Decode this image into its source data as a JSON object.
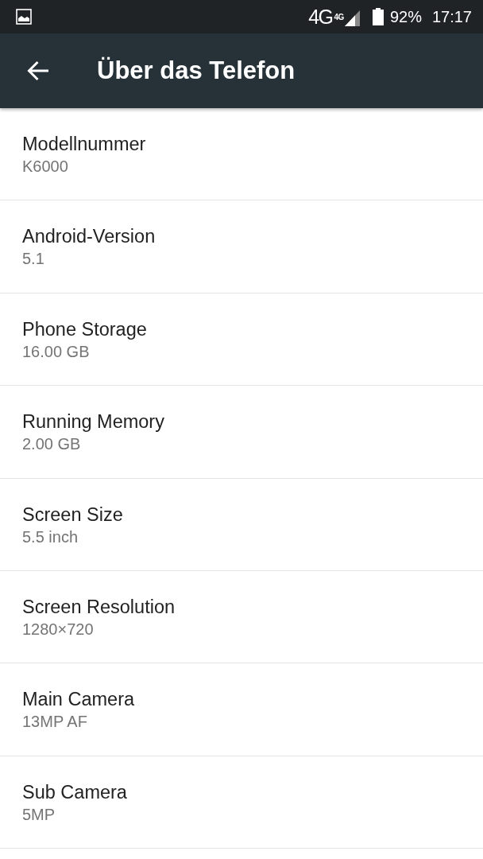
{
  "status_bar": {
    "network": "4G",
    "network_badge": "4G",
    "battery": "92%",
    "time": "17:17"
  },
  "app_bar": {
    "title": "Über das Telefon"
  },
  "items": [
    {
      "title": "Modellnummer",
      "summary": "K6000"
    },
    {
      "title": "Android-Version",
      "summary": "5.1"
    },
    {
      "title": "Phone Storage",
      "summary": "16.00 GB"
    },
    {
      "title": "Running Memory",
      "summary": "2.00 GB"
    },
    {
      "title": "Screen Size",
      "summary": "5.5 inch"
    },
    {
      "title": "Screen Resolution",
      "summary": "1280×720"
    },
    {
      "title": "Main Camera",
      "summary": "13MP AF"
    },
    {
      "title": "Sub Camera",
      "summary": "5MP"
    }
  ]
}
